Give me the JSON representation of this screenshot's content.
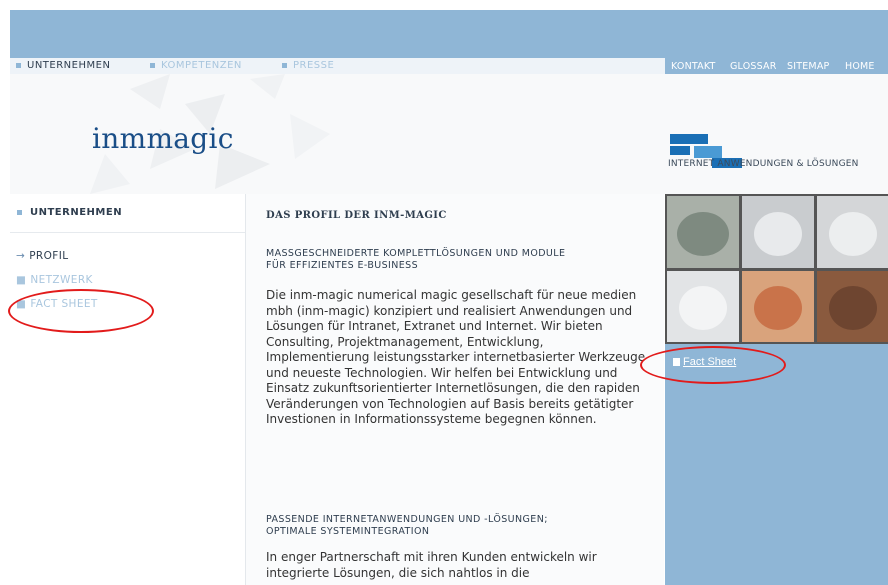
{
  "nav": {
    "main": [
      "UNTERNEHMEN",
      "KOMPETENZEN",
      "PRESSE"
    ],
    "utility": [
      "KONTAKT",
      "GLOSSAR",
      "SITEMAP",
      "HOME"
    ]
  },
  "brand": {
    "logo_text": "inmmagic",
    "tagline": "INTERNET ANWENDUNGEN & LÖSUNGEN"
  },
  "sidebar": {
    "heading": "UNTERNEHMEN",
    "items": [
      "PROFIL",
      "NETZWERK",
      "FACT SHEET"
    ]
  },
  "content": {
    "title": "DAS PROFIL DER INM-MAGIC",
    "section1_heading": "MASSGESCHNEIDERTE KOMPLETTLÖSUNGEN UND MODULE\nFÜR EFFIZIENTES E-BUSINESS",
    "section1_text": "Die inm-magic numerical magic gesellschaft für neue medien mbh (inm-magic) konzipiert und realisiert Anwendungen und Lösungen für Intranet, Extranet und Internet. Wir bieten Consulting, Projektmanagement, Entwicklung, Implementierung leistungsstarker internetbasierter Werkzeuge und neueste Technologien. Wir helfen bei Entwicklung und Einsatz zukunftsorientierter Internetlösungen, die den rapiden Veränderungen von Technologien auf Basis bereits getätigter Investionen in Informationssysteme begegnen können.",
    "section2_heading": "PASSENDE INTERNETANWENDUNGEN UND -LÖSUNGEN;\nOPTIMALE SYSTEMINTEGRATION",
    "section2_text": "In enger Partnerschaft mit ihren Kunden entwickeln wir integrierte Lösungen, die sich nahtlos in die"
  },
  "right": {
    "fact_sheet_link": "Fact Sheet"
  },
  "colors": {
    "band_blue": "#8fb6d6",
    "nav_dim": "#a9c6de",
    "logo_blue": "#1a4e87",
    "annotation_red": "#e21b1b"
  }
}
